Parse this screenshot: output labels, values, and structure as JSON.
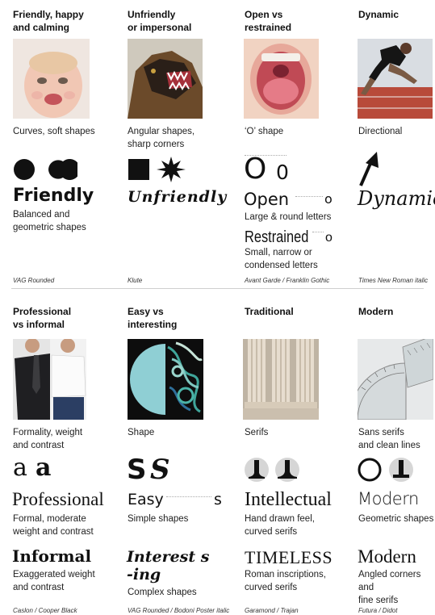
{
  "top": {
    "friendly": {
      "heading": "Friendly, happy\nand calming",
      "image": "baby-smiling-photo",
      "feature": "Curves, soft shapes",
      "sample": "Friendly",
      "desc": "Balanced and\ngeometric shapes",
      "credit": "VAG Rounded"
    },
    "unfriendly": {
      "heading": "Unfriendly\nor impersonal",
      "image": "snarling-dog-photo",
      "feature": "Angular shapes,\nsharp corners",
      "sample": "Unfriendly",
      "credit": "Klute"
    },
    "open": {
      "heading": "Open vs\nrestrained",
      "image": "open-mouth-photo",
      "feature": "‘O’ shape",
      "glyph_letters": "O",
      "glyph_small": "0",
      "sample_open": "Open",
      "sample_open_o": "o",
      "desc_open": "Large & round letters",
      "sample_restrained": "Restrained",
      "sample_restrained_o": "o",
      "desc_restrained": "Small, narrow or\ncondensed letters",
      "credit": "Avant Garde / Franklin Gothic"
    },
    "dynamic": {
      "heading": "Dynamic",
      "image": "sprinter-photo",
      "feature": "Directional",
      "sample": "Dynamic",
      "credit": "Times New Roman italic"
    }
  },
  "bottom": {
    "professional": {
      "heading": "Professional\nvs informal",
      "image": "suit-and-tshirt-photo",
      "feature": "Formality, weight\nand contrast",
      "glyph_a1": "a",
      "glyph_a2": "a",
      "sample_professional": "Professional",
      "desc_professional": "Formal, moderate\nweight and contrast",
      "sample_informal": "Informal",
      "desc_informal": "Exaggerated weight\nand contrast",
      "credit": "Caslon / Cooper Black"
    },
    "easy": {
      "heading": "Easy vs\ninteresting",
      "image": "circle-and-pattern-photo",
      "feature": "Shape",
      "glyph_s1": "S",
      "glyph_s2": "S",
      "sample_easy": "Easy",
      "sample_easy_s": "s",
      "desc_easy": "Simple shapes",
      "sample_interest": "Interest s",
      "sample_ing": "-ing",
      "desc_interest": "Complex shapes",
      "credit": "VAG Rounded / Bodoni Poster italic"
    },
    "traditional": {
      "heading": "Traditional",
      "image": "classical-columns-photo",
      "feature": "Serifs",
      "sample_intellectual": "Intellectual",
      "desc_intellectual": "Hand drawn feel,\ncurved serifs",
      "sample_timeless": "TIMELESS",
      "desc_timeless": "Roman inscriptions,\ncurved serifs",
      "credit": "Garamond / Trajan"
    },
    "modern": {
      "heading": "Modern",
      "image": "protractor-photo",
      "feature": "Sans serifs\nand clean lines",
      "sample_modern1": "Modern",
      "desc_modern1": "Geometric shapes",
      "sample_modern2": "Modern",
      "desc_modern2": "Angled corners and\nfine serifs",
      "credit": "Futura / Didot"
    }
  }
}
